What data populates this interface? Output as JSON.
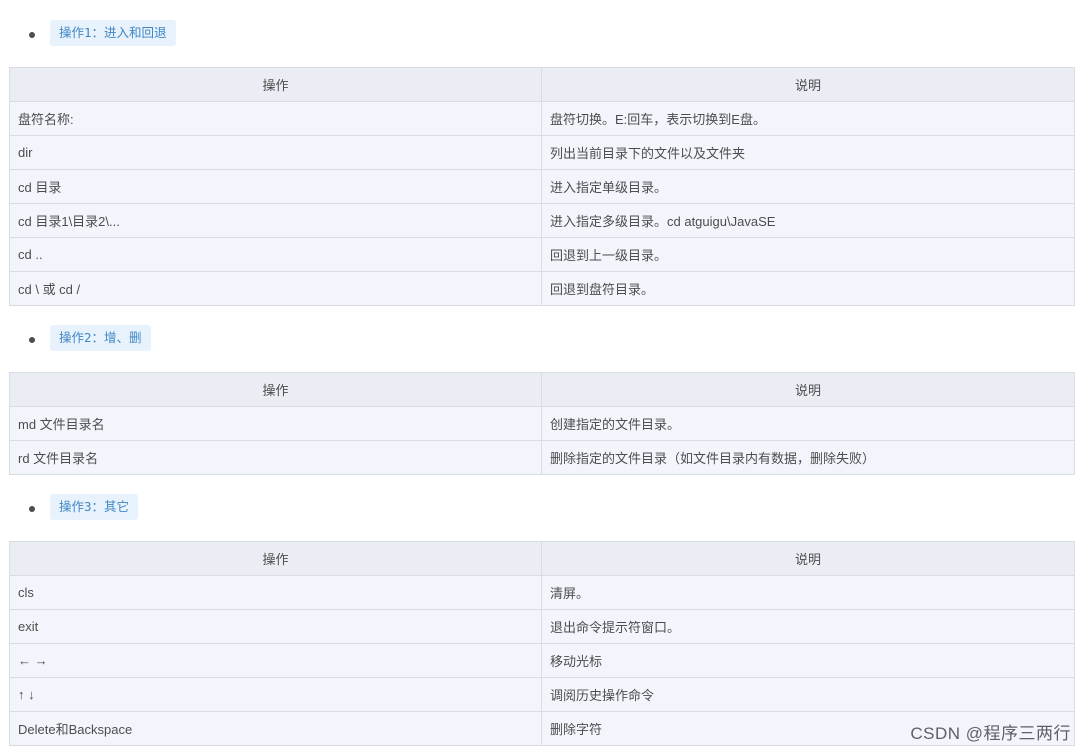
{
  "sections": [
    {
      "tag": "操作1：进入和回退",
      "header": [
        "操作",
        "说明"
      ],
      "rows": [
        [
          "盘符名称:",
          "盘符切换。E:回车，表示切换到E盘。"
        ],
        [
          "dir",
          "列出当前目录下的文件以及文件夹"
        ],
        [
          "cd 目录",
          "进入指定单级目录。"
        ],
        [
          "cd 目录1\\目录2\\...",
          "进入指定多级目录。cd atguigu\\JavaSE"
        ],
        [
          "cd ..",
          "回退到上一级目录。"
        ],
        [
          "cd \\ 或 cd /",
          "回退到盘符目录。"
        ]
      ]
    },
    {
      "tag": "操作2：增、删",
      "header": [
        "操作",
        "说明"
      ],
      "rows": [
        [
          "md 文件目录名",
          "创建指定的文件目录。"
        ],
        [
          "rd 文件目录名",
          "删除指定的文件目录（如文件目录内有数据，删除失败）"
        ]
      ]
    },
    {
      "tag": "操作3：其它",
      "header": [
        "操作",
        "说明"
      ],
      "rows": [
        [
          "cls",
          "清屏。"
        ],
        [
          "exit",
          "退出命令提示符窗口。"
        ],
        [
          "← →",
          "移动光标"
        ],
        [
          "↑ ↓",
          "调阅历史操作命令"
        ],
        [
          "Delete和Backspace",
          "删除字符"
        ]
      ]
    }
  ],
  "watermark": "CSDN @程序三两行"
}
